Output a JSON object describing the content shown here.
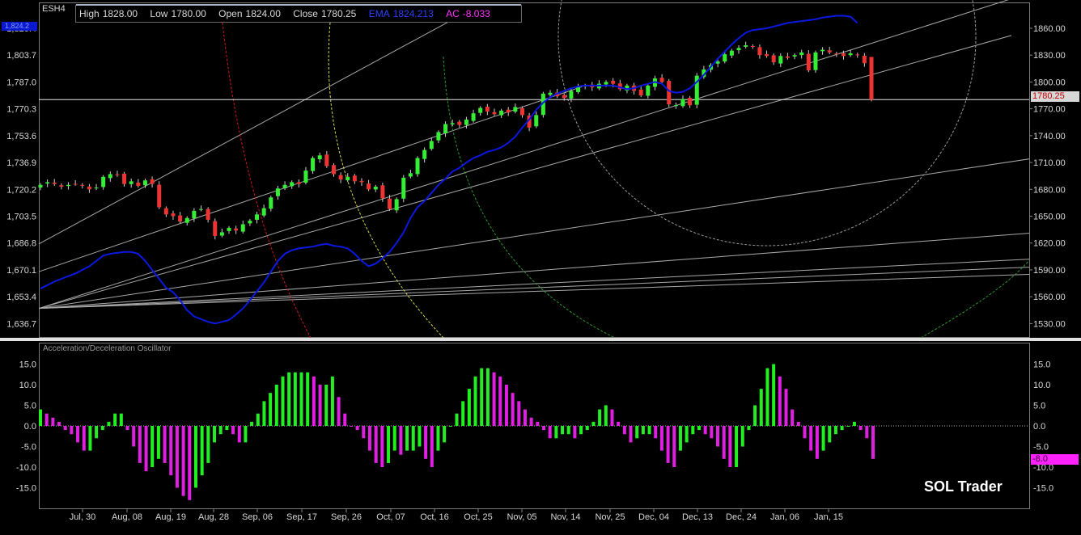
{
  "symbol": "ESH4",
  "ema_badge": "1,824.2",
  "infobar": {
    "high_label": "High",
    "high_value": "1828.00",
    "low_label": "Low",
    "low_value": "1780.00",
    "open_label": "Open",
    "open_value": "1824.00",
    "close_label": "Close",
    "close_value": "1780.25",
    "ema_label": "EMA",
    "ema_value": "1824.213",
    "ac_label": "AC",
    "ac_value": "-8.033"
  },
  "price_tag": "1780.25",
  "ac_tag": "-8.0",
  "oscillator_title": "Acceleration/Deceleration Oscillator",
  "brand": "SOL Trader",
  "colors": {
    "background": "#000000",
    "candle_up": "#33ee33",
    "candle_down": "#ee3333",
    "ema": "#0a18e0",
    "ac_up": "#22ee22",
    "ac_down": "#e020e0",
    "gann_line": "#a8a8a8",
    "arc_red": "#d01818",
    "arc_yellow": "#d8d840",
    "arc_green": "#2a9a2a",
    "arc_grey": "#9a9a9a"
  },
  "chart_data": [
    {
      "type": "candlestick",
      "title": "",
      "left_axis_ticks": [
        "1,820.4",
        "1,803.7",
        "1,787.0",
        "1,770.3",
        "1,753.6",
        "1,736.9",
        "1,720.2",
        "1,703.5",
        "1,686.8",
        "1,670.1",
        "1,653.4",
        "1,636.7"
      ],
      "right_axis_ticks": [
        "1860.00",
        "1830.00",
        "1800.00",
        "1770.00",
        "1740.00",
        "1710.00",
        "1680.00",
        "1650.00",
        "1620.00",
        "1590.00",
        "1560.00",
        "1530.00"
      ],
      "x_tick_labels": [
        "Jul, 30",
        "Aug, 08",
        "Aug, 19",
        "Aug, 28",
        "Sep, 06",
        "Sep, 17",
        "Sep, 26",
        "Oct, 07",
        "Oct, 16",
        "Oct, 25",
        "Nov, 05",
        "Nov, 14",
        "Nov, 25",
        "Dec, 04",
        "Dec, 13",
        "Dec, 24",
        "Jan, 06",
        "Jan, 15"
      ],
      "ylim": [
        1515,
        1888
      ],
      "last_close": 1780.25,
      "close": [
        1685,
        1688,
        1686,
        1683,
        1685,
        1686,
        1684,
        1680,
        1682,
        1694,
        1697,
        1696,
        1686,
        1689,
        1684,
        1690,
        1686,
        1660,
        1652,
        1650,
        1644,
        1648,
        1656,
        1658,
        1646,
        1628,
        1632,
        1637,
        1634,
        1641,
        1645,
        1652,
        1659,
        1671,
        1681,
        1685,
        1688,
        1686,
        1701,
        1715,
        1718,
        1706,
        1697,
        1691,
        1694,
        1689,
        1688,
        1680,
        1683,
        1670,
        1658,
        1669,
        1693,
        1698,
        1715,
        1724,
        1734,
        1744,
        1753,
        1754,
        1752,
        1758,
        1765,
        1771,
        1767,
        1764,
        1768,
        1766,
        1772,
        1763,
        1749,
        1763,
        1787,
        1788,
        1784,
        1782,
        1790,
        1794,
        1796,
        1794,
        1798,
        1800,
        1798,
        1792,
        1796,
        1790,
        1785,
        1796,
        1804,
        1800,
        1775,
        1774,
        1781,
        1774,
        1807,
        1814,
        1819,
        1823,
        1831,
        1835,
        1838,
        1841,
        1840,
        1830,
        1829,
        1822,
        1829,
        1827,
        1830,
        1833,
        1813,
        1833,
        1836,
        1833,
        1831,
        1829,
        1832,
        1830,
        1821,
        1780.25
      ],
      "ema": [
        1569,
        1573,
        1577,
        1580,
        1583,
        1586,
        1590,
        1594,
        1600,
        1606,
        1608,
        1609,
        1610,
        1610,
        1608,
        1600,
        1590,
        1580,
        1570,
        1565,
        1556,
        1545,
        1538,
        1535,
        1532,
        1530,
        1532,
        1534,
        1540,
        1547,
        1556,
        1566,
        1576,
        1588,
        1600,
        1608,
        1612,
        1614,
        1615,
        1616,
        1618,
        1619,
        1617,
        1616,
        1614,
        1608,
        1600,
        1594,
        1597,
        1603,
        1610,
        1620,
        1632,
        1648,
        1660,
        1667,
        1676,
        1685,
        1692,
        1700,
        1704,
        1710,
        1715,
        1718,
        1722,
        1724,
        1727,
        1732,
        1739,
        1749,
        1758,
        1769,
        1777,
        1783,
        1787,
        1790,
        1793,
        1795,
        1796,
        1796,
        1796,
        1796,
        1796,
        1794,
        1792,
        1793,
        1796,
        1798,
        1800,
        1798,
        1790,
        1788,
        1789,
        1793,
        1800,
        1808,
        1817,
        1826,
        1834,
        1842,
        1849,
        1855,
        1858,
        1859,
        1860,
        1862,
        1864,
        1866,
        1867,
        1868,
        1869,
        1870,
        1872,
        1873,
        1874,
        1874,
        1873,
        1866
      ]
    },
    {
      "type": "bar",
      "title": "Acceleration/Deceleration Oscillator",
      "y_ticks": [
        15,
        10,
        5,
        0,
        -5,
        -10,
        -15
      ],
      "y_tick_labels": [
        "15.0",
        "10.0",
        "5.0",
        "0.0",
        "-5.0",
        "-10.0",
        "-15.0"
      ],
      "ylim": [
        -20,
        20
      ],
      "values": [
        4,
        3,
        2,
        1,
        -1,
        -2,
        -4,
        -6,
        -6,
        -3,
        -1,
        1,
        3,
        3,
        -1,
        -5,
        -9,
        -11,
        -10,
        -8,
        -9,
        -12,
        -15,
        -17,
        -18,
        -15,
        -12,
        -9,
        -4,
        -2,
        -1,
        -2,
        -4,
        -4,
        1,
        3,
        6,
        8,
        10,
        12,
        13,
        13,
        13,
        13,
        12,
        10,
        10,
        12,
        7,
        3,
        0,
        -1,
        -3,
        -6,
        -9,
        -10,
        -9,
        -6,
        -7,
        -6,
        -6,
        -5,
        -8,
        -10,
        -6,
        -4,
        0,
        3,
        6,
        9,
        12,
        14,
        14,
        13,
        12,
        10,
        8,
        6,
        4,
        2,
        1,
        -1,
        -3,
        -3,
        -2,
        -2,
        -3,
        -2,
        -1,
        1,
        4,
        5,
        4,
        1,
        -2,
        -4,
        -3,
        -2,
        -2,
        -3,
        -6,
        -9,
        -10,
        -6,
        -4,
        -2,
        -1,
        -2,
        -3,
        -5,
        -8,
        -10,
        -10,
        -5,
        -1,
        5,
        9,
        14,
        15,
        12,
        9,
        4,
        1,
        -3,
        -6,
        -8,
        -6,
        -4,
        -2,
        -1,
        0,
        1,
        -1,
        -3,
        -8
      ]
    }
  ]
}
